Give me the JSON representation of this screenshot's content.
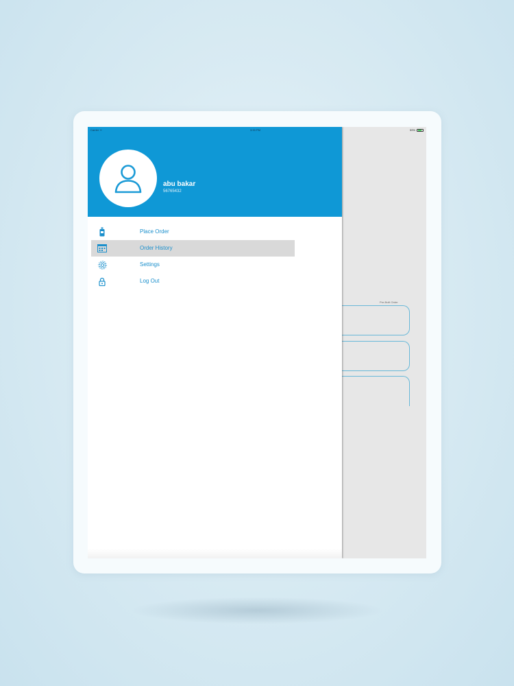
{
  "statusbar": {
    "carrier": "Carrier ᯤ",
    "time": "3:33 PM",
    "battery": "59%"
  },
  "profile": {
    "name": "abu bakar",
    "phone": "56765432"
  },
  "menu": {
    "items": [
      {
        "label": "Place Order",
        "icon": "water-bottle-icon"
      },
      {
        "label": "Order History",
        "icon": "history-calendar-icon"
      },
      {
        "label": "Settings",
        "icon": "gear-icon"
      },
      {
        "label": "Log Out",
        "icon": "lock-icon"
      }
    ],
    "active_index": 1
  },
  "background_screen": {
    "label": "Pre-Built Order"
  },
  "colors": {
    "accent": "#0f98d6",
    "menu_text": "#1a8fcc",
    "highlight": "#d9d9d9",
    "field_border": "#68b8d8"
  }
}
